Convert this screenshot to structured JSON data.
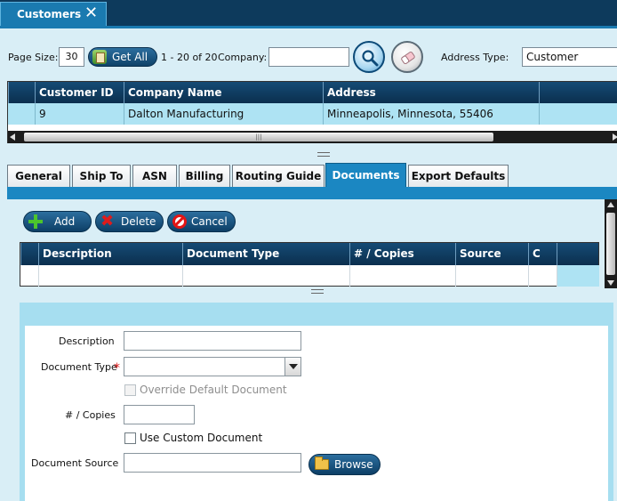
{
  "window": {
    "tab_title": "Customers",
    "close_glyph": "✕"
  },
  "toolbar": {
    "page_size_label": "Page Size:",
    "page_size_value": "30",
    "get_all_label": "Get All",
    "range_text": "1 - 20 of 20",
    "company_label": "Company:",
    "company_value": "",
    "address_type_label": "Address Type:",
    "address_type_value": "Customer"
  },
  "customer_grid": {
    "columns": [
      "Customer ID",
      "Company Name",
      "Address"
    ],
    "rows": [
      {
        "customer_id": "9",
        "company_name": "Dalton Manufacturing",
        "address": "Minneapolis, Minnesota, 55406"
      }
    ]
  },
  "detail_tabs": {
    "items": [
      "General",
      "Ship To",
      "ASN",
      "Billing",
      "Routing Guide",
      "Documents",
      "Export Defaults"
    ],
    "active": "Documents"
  },
  "documents": {
    "actions": {
      "add": "Add",
      "delete": "Delete",
      "cancel": "Cancel"
    },
    "columns": [
      "Description",
      "Document Type",
      "# / Copies",
      "Source",
      "C"
    ],
    "form": {
      "description_label": "Description",
      "description_value": "",
      "document_type_label": "Document Type",
      "document_type_value": "",
      "required_marker": "*",
      "override_label": "Override Default Document",
      "override_checked": false,
      "copies_label": "# / Copies",
      "copies_value": "",
      "custom_label": "Use Custom Document",
      "custom_checked": false,
      "source_label": "Document Source",
      "source_value": "",
      "browse_label": "Browse"
    }
  },
  "colors": {
    "header_dark": "#0d3a5c",
    "accent_blue": "#1b87c2",
    "selected_row": "#aee3f3",
    "panel_bg": "#d9eef6"
  }
}
